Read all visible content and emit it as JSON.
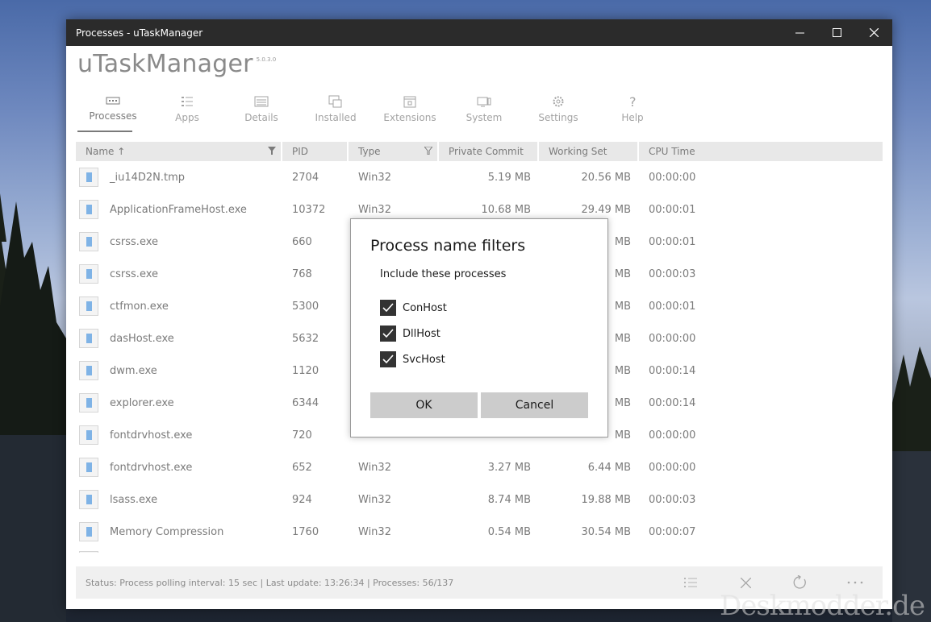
{
  "window": {
    "title": "Processes - uTaskManager"
  },
  "app": {
    "name": "uTaskManager",
    "version": "5.0.3.0"
  },
  "nav": {
    "items": [
      {
        "label": "Processes",
        "icon": "processes-icon",
        "active": true
      },
      {
        "label": "Apps",
        "icon": "apps-icon"
      },
      {
        "label": "Details",
        "icon": "details-icon"
      },
      {
        "label": "Installed",
        "icon": "installed-icon"
      },
      {
        "label": "Extensions",
        "icon": "extensions-icon"
      },
      {
        "label": "System",
        "icon": "system-icon"
      },
      {
        "label": "Settings",
        "icon": "gear-icon"
      },
      {
        "label": "Help",
        "icon": "help-icon"
      }
    ]
  },
  "table": {
    "columns": [
      "Name ↑",
      "PID",
      "Type",
      "Private Commit",
      "Working Set",
      "CPU Time"
    ],
    "rows": [
      {
        "name": "_iu14D2N.tmp",
        "pid": "2704",
        "type": "Win32",
        "private": "5.19 MB",
        "working": "20.56 MB",
        "cpu": "00:00:00"
      },
      {
        "name": "ApplicationFrameHost.exe",
        "pid": "10372",
        "type": "Win32",
        "private": "10.68 MB",
        "working": "29.49 MB",
        "cpu": "00:00:01"
      },
      {
        "name": "csrss.exe",
        "pid": "660",
        "type": "",
        "private": "",
        "working": "MB",
        "cpu": "00:00:01"
      },
      {
        "name": "csrss.exe",
        "pid": "768",
        "type": "",
        "private": "",
        "working": "MB",
        "cpu": "00:00:03"
      },
      {
        "name": "ctfmon.exe",
        "pid": "5300",
        "type": "",
        "private": "",
        "working": "MB",
        "cpu": "00:00:01"
      },
      {
        "name": "dasHost.exe",
        "pid": "5632",
        "type": "",
        "private": "",
        "working": "MB",
        "cpu": "00:00:00"
      },
      {
        "name": "dwm.exe",
        "pid": "1120",
        "type": "",
        "private": "",
        "working": "MB",
        "cpu": "00:00:14"
      },
      {
        "name": "explorer.exe",
        "pid": "6344",
        "type": "",
        "private": "",
        "working": "MB",
        "cpu": "00:00:14"
      },
      {
        "name": "fontdrvhost.exe",
        "pid": "720",
        "type": "",
        "private": "",
        "working": "MB",
        "cpu": "00:00:00"
      },
      {
        "name": "fontdrvhost.exe",
        "pid": "652",
        "type": "Win32",
        "private": "3.27 MB",
        "working": "6.44 MB",
        "cpu": "00:00:00"
      },
      {
        "name": "lsass.exe",
        "pid": "924",
        "type": "Win32",
        "private": "8.74 MB",
        "working": "19.88 MB",
        "cpu": "00:00:03"
      },
      {
        "name": "Memory Compression",
        "pid": "1760",
        "type": "Win32",
        "private": "0.54 MB",
        "working": "30.54 MB",
        "cpu": "00:00:07"
      }
    ]
  },
  "status": {
    "text": "Status: Process polling interval: 15 sec | Last update: 13:26:34 | Processes: 56/137"
  },
  "dialog": {
    "title": "Process name filters",
    "subtitle": "Include these processes",
    "options": [
      {
        "label": "ConHost",
        "checked": true
      },
      {
        "label": "DllHost",
        "checked": true
      },
      {
        "label": "SvcHost",
        "checked": true
      }
    ],
    "ok_label": "OK",
    "cancel_label": "Cancel"
  },
  "watermark": "Deskmodder.de"
}
